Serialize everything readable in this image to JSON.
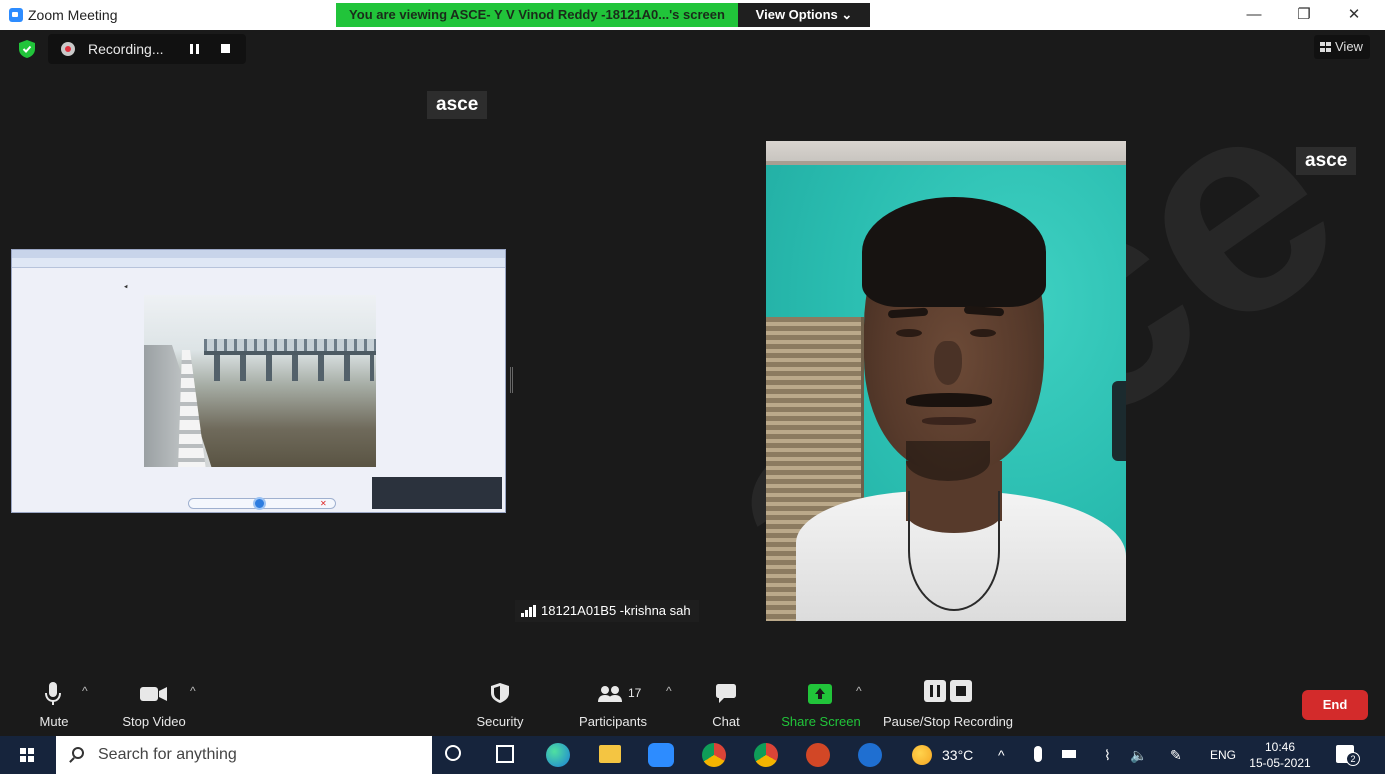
{
  "window": {
    "title": "Zoom Meeting",
    "viewing_banner": "You are viewing ASCE- Y V Vinod Reddy -18121A0...'s screen",
    "view_options": "View Options",
    "controls": {
      "minimize": "—",
      "restore": "❐",
      "close": "✕"
    }
  },
  "meeting": {
    "recording_text": "Recording...",
    "view_label": "View",
    "shared_screen_name_tag": "asce",
    "video_name_tag": "asce",
    "participant_label": "18121A01B5 -krishna sah",
    "watermark_text": "asce"
  },
  "toolbar": {
    "mute": "Mute",
    "stop_video": "Stop Video",
    "security": "Security",
    "participants": "Participants",
    "participants_count": "17",
    "chat": "Chat",
    "share_screen": "Share Screen",
    "pause_stop_recording": "Pause/Stop Recording",
    "end": "End"
  },
  "taskbar": {
    "search_placeholder": "Search for anything",
    "weather": "33°C",
    "language": "ENG",
    "time": "10:46",
    "date": "15-05-2021",
    "notification_count": "2"
  },
  "colors": {
    "banner_green": "#21c43a",
    "share_green": "#21c43a",
    "end_red": "#d32b2b",
    "zoom_blue": "#2d8cff",
    "taskbar": "#16243c"
  }
}
